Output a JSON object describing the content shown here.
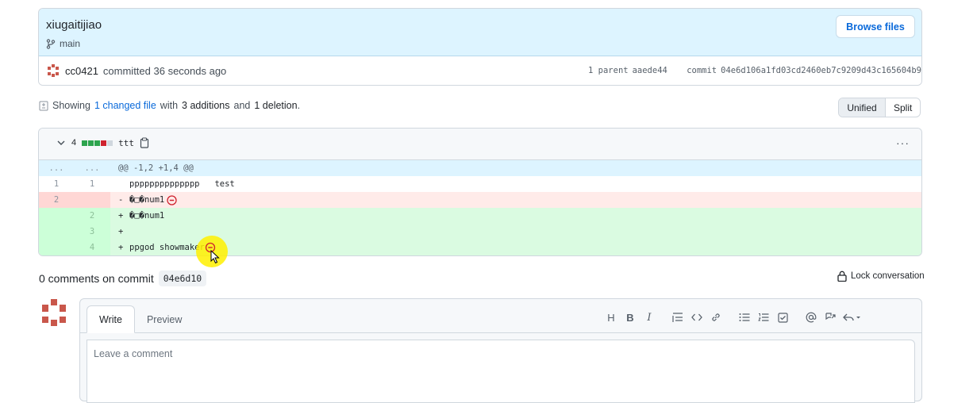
{
  "commit": {
    "title": "xiugaitijiao",
    "branch": "main",
    "browse_label": "Browse files",
    "author": "cc0421",
    "committed_text": "committed 36 seconds ago",
    "parent_label": "1 parent",
    "parent_sha": "aaede44",
    "commit_label": "commit",
    "commit_sha": "04e6d106a1fd03cd2460eb7c9209d43c165604b9"
  },
  "summary": {
    "showing": "Showing",
    "changed_files": "1 changed file",
    "with": "with",
    "additions": "3 additions",
    "and": "and",
    "deletions": "1 deletion",
    "period": "."
  },
  "view_toggle": {
    "unified": "Unified",
    "split": "Split"
  },
  "diff": {
    "change_count": "4",
    "file_name": "ttt",
    "more": "···",
    "hunk_header": "@@ -1,2 +1,4 @@",
    "hunk_dots_left": "...",
    "hunk_dots_right": "...",
    "lines": [
      {
        "type": "context",
        "old": "1",
        "new": "1",
        "sign": " ",
        "text": "pppppppppppppp   test"
      },
      {
        "type": "deletion",
        "old": "2",
        "new": "",
        "sign": "-",
        "text": "�□�num1"
      },
      {
        "type": "addition",
        "old": "",
        "new": "2",
        "sign": "+",
        "text": "�□�num1"
      },
      {
        "type": "addition",
        "old": "",
        "new": "3",
        "sign": "+",
        "text": ""
      },
      {
        "type": "addition",
        "old": "",
        "new": "4",
        "sign": "+",
        "text": "ppgod showmaker"
      }
    ]
  },
  "comments": {
    "count_text": "0 comments on commit",
    "short_sha": "04e6d10",
    "lock_label": "Lock conversation"
  },
  "editor": {
    "tab_write": "Write",
    "tab_preview": "Preview",
    "placeholder": "Leave a comment",
    "toolbar": [
      "H",
      "B",
      "I"
    ]
  },
  "colors": {
    "accent": "#0969da",
    "addition": "#2da44e",
    "deletion": "#cf222e",
    "avatar": "#c9574b"
  }
}
